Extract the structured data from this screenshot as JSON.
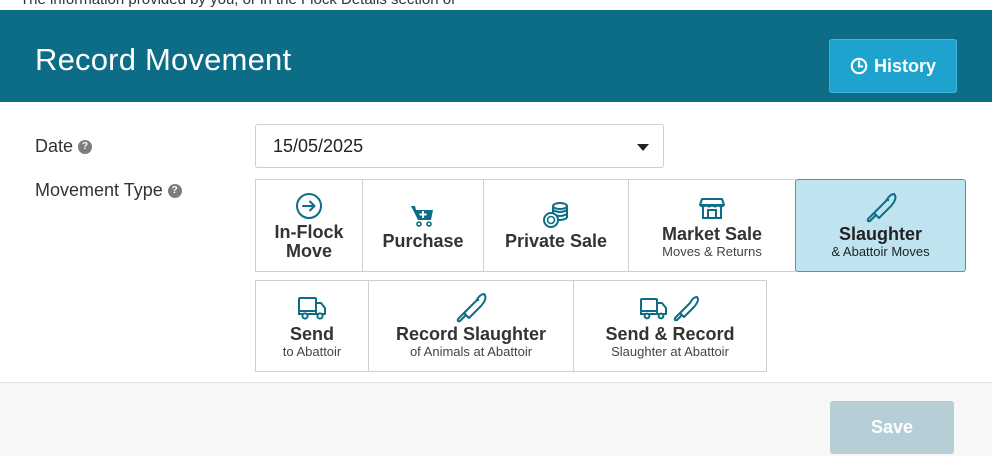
{
  "header": {
    "title": "Record Movement",
    "history_label": "History"
  },
  "top_strip_text": "The information provided by you, or in the Flock Details section of",
  "form": {
    "date_label": "Date",
    "date_value": "15/05/2025",
    "movement_type_label": "Movement Type"
  },
  "movement_types": [
    {
      "main_line1": "In-Flock",
      "main_line2": "Move",
      "sub": "",
      "icon": "arrow-circle-icon",
      "selected": false
    },
    {
      "main_line1": "Purchase",
      "main_line2": "",
      "sub": "",
      "icon": "cart-icon",
      "selected": false
    },
    {
      "main_line1": "Private Sale",
      "main_line2": "",
      "sub": "",
      "icon": "coins-icon",
      "selected": false
    },
    {
      "main_line1": "Market Sale",
      "main_line2": "",
      "sub": "Moves & Returns",
      "icon": "store-icon",
      "selected": false
    },
    {
      "main_line1": "Slaughter",
      "main_line2": "",
      "sub": "& Abattoir Moves",
      "icon": "knife-icon",
      "selected": true
    },
    {
      "main_line1": "Send",
      "main_line2": "",
      "sub": "to Abattoir",
      "icon": "truck-icon",
      "selected": false
    },
    {
      "main_line1": "Record Slaughter",
      "main_line2": "",
      "sub": "of Animals at Abattoir",
      "icon": "knife-icon",
      "selected": false
    },
    {
      "main_line1": "Send & Record",
      "main_line2": "",
      "sub": "Slaughter at Abattoir",
      "icon": "truck-knife-icon",
      "selected": false
    }
  ],
  "footer": {
    "save_label": "Save"
  },
  "colors": {
    "header_bg": "#0d6d87",
    "accent": "#1ea3cf",
    "selected_bg": "#bfe4f0",
    "save_disabled": "#b6ced5"
  }
}
